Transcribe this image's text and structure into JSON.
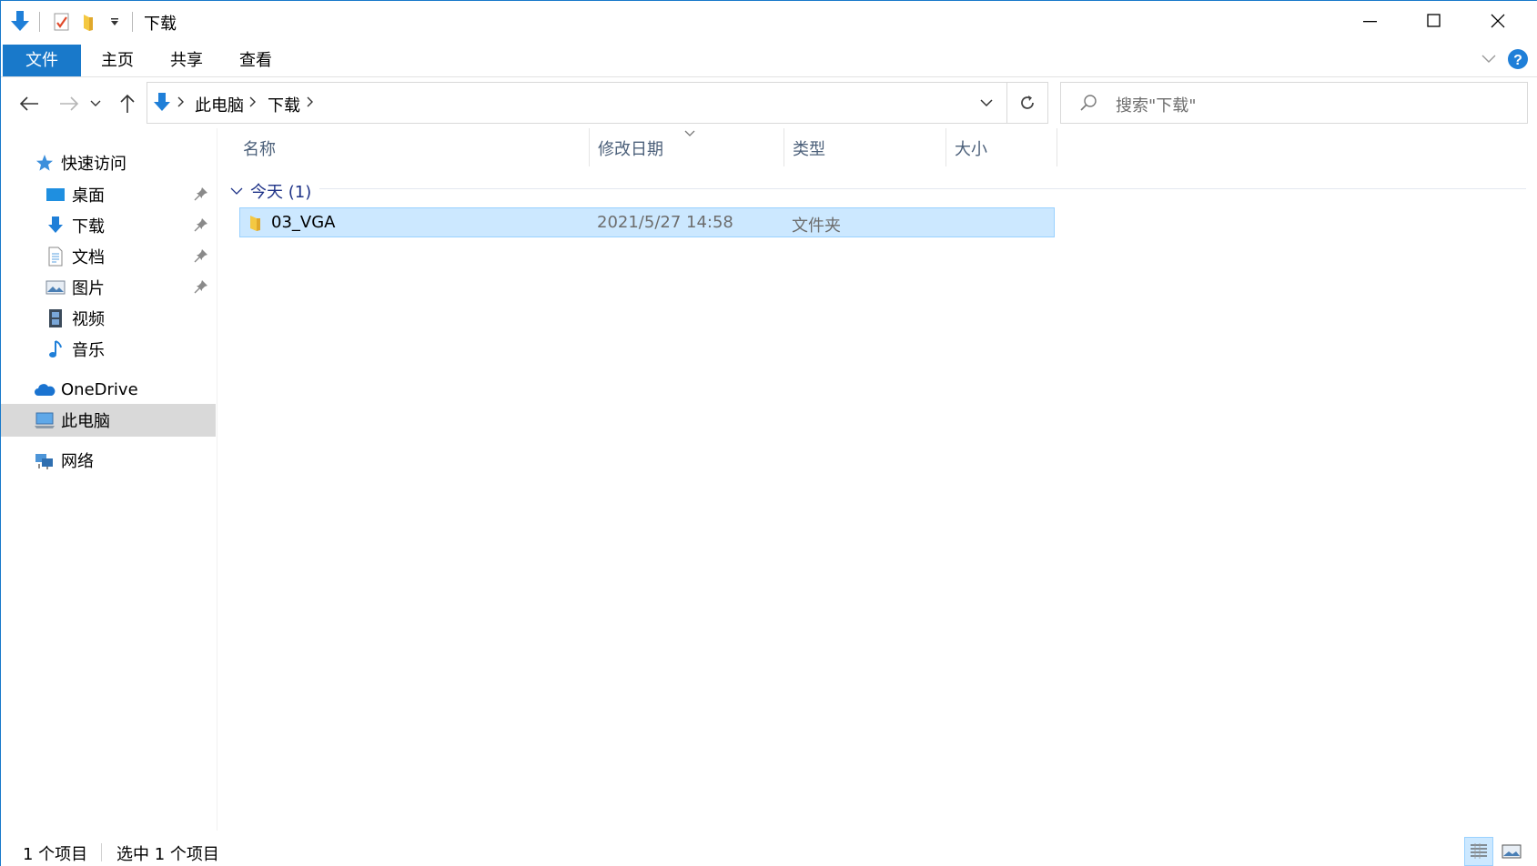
{
  "window": {
    "title": "下载"
  },
  "ribbon": {
    "tabs": [
      {
        "label": "文件"
      },
      {
        "label": "主页"
      },
      {
        "label": "共享"
      },
      {
        "label": "查看"
      }
    ]
  },
  "address": {
    "crumbs": [
      "此电脑",
      "下载"
    ],
    "search_placeholder": "搜索\"下载\""
  },
  "nav": {
    "quick_access": "快速访问",
    "items": [
      {
        "label": "桌面",
        "pinned": true
      },
      {
        "label": "下载",
        "pinned": true
      },
      {
        "label": "文档",
        "pinned": true
      },
      {
        "label": "图片",
        "pinned": true
      },
      {
        "label": "视频",
        "pinned": false
      },
      {
        "label": "音乐",
        "pinned": false
      }
    ],
    "onedrive": "OneDrive",
    "this_pc": "此电脑",
    "network": "网络"
  },
  "columns": {
    "name": "名称",
    "modified": "修改日期",
    "type": "类型",
    "size": "大小"
  },
  "group": {
    "label": "今天 (1)"
  },
  "files": [
    {
      "name": "03_VGA",
      "modified": "2021/5/27 14:58",
      "type": "文件夹",
      "size": ""
    }
  ],
  "status": {
    "count": "1 个项目",
    "selected": "选中 1 个项目"
  },
  "colors": {
    "accent": "#1979ca",
    "selection": "#cce8ff",
    "folder": "#f4c842"
  }
}
